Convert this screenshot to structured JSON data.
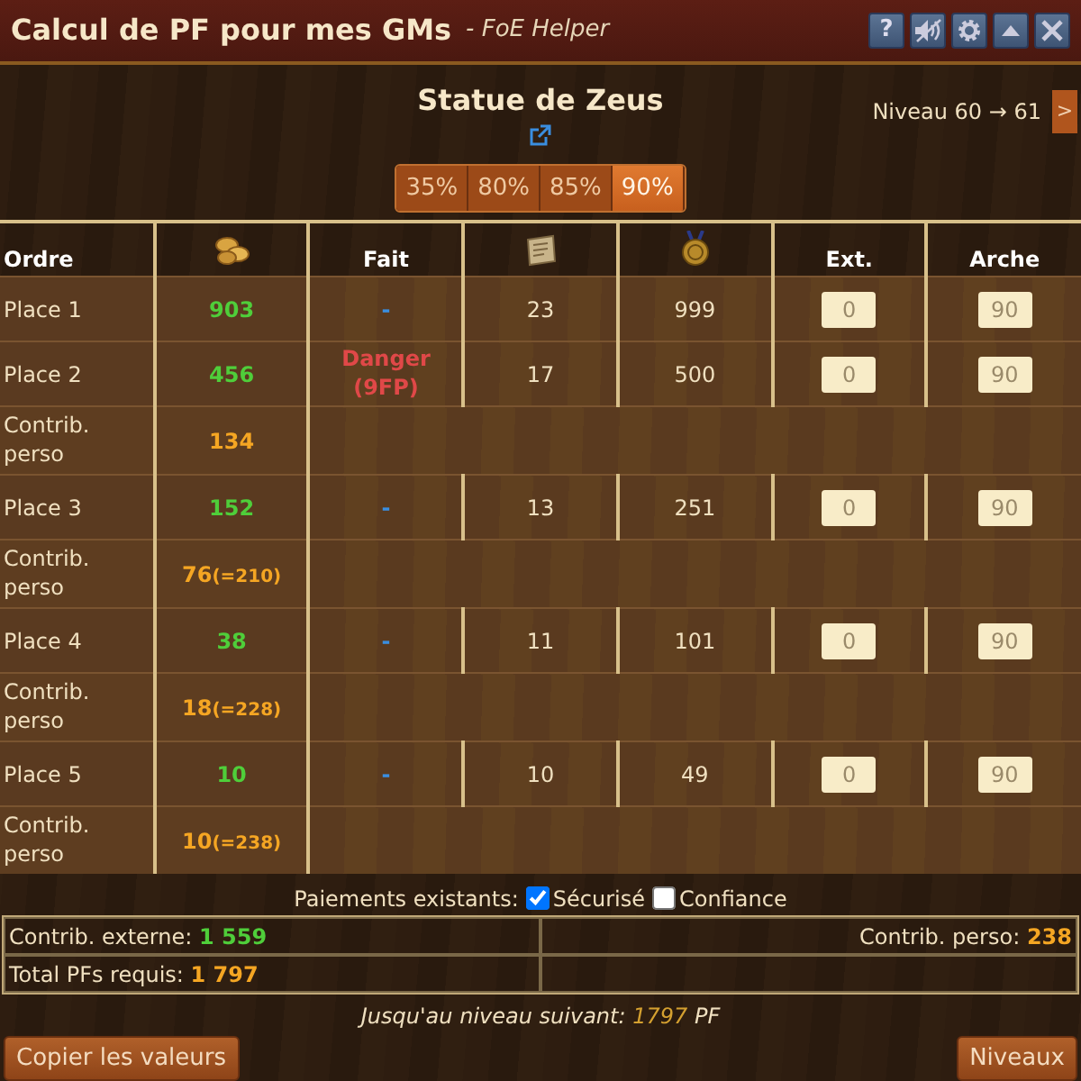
{
  "window": {
    "title": "Calcul de PF pour mes GMs",
    "subtitle": "- FoE Helper",
    "buttons": [
      {
        "kind": "help",
        "label": "?"
      },
      {
        "kind": "mute"
      },
      {
        "kind": "settings"
      },
      {
        "kind": "collapse"
      },
      {
        "kind": "close"
      }
    ]
  },
  "building": {
    "name": "Statue de Zeus",
    "level": "Niveau 60 → 61",
    "next": ">"
  },
  "percentages": [
    {
      "label": "35%",
      "selected": false
    },
    {
      "label": "80%",
      "selected": false
    },
    {
      "label": "85%",
      "selected": false
    },
    {
      "label": "90%",
      "selected": true
    }
  ],
  "columns": [
    {
      "kind": "text",
      "label": "Ordre"
    },
    {
      "kind": "fp-icon"
    },
    {
      "kind": "text",
      "label": "Fait"
    },
    {
      "kind": "blueprint-icon"
    },
    {
      "kind": "medal-icon"
    },
    {
      "kind": "text",
      "label": "Ext."
    },
    {
      "kind": "text",
      "label": "Arche"
    }
  ],
  "rows": [
    {
      "kind": "place",
      "label": "Place 1",
      "fp": "903",
      "fait": "-",
      "danger": false,
      "blueprints": "23",
      "medals": "999",
      "ext": "0",
      "arche": "90"
    },
    {
      "kind": "place",
      "label": "Place 2",
      "fp": "456",
      "fait": "Danger (9FP)",
      "danger": true,
      "blueprints": "17",
      "medals": "500",
      "ext": "0",
      "arche": "90"
    },
    {
      "kind": "contrib",
      "label": "Contrib. perso",
      "value": "134"
    },
    {
      "kind": "place",
      "label": "Place 3",
      "fp": "152",
      "fait": "-",
      "danger": false,
      "blueprints": "13",
      "medals": "251",
      "ext": "0",
      "arche": "90"
    },
    {
      "kind": "contrib",
      "label": "Contrib. perso",
      "value": "76",
      "total": "(=210)"
    },
    {
      "kind": "place",
      "label": "Place 4",
      "fp": "38",
      "fait": "-",
      "danger": false,
      "blueprints": "11",
      "medals": "101",
      "ext": "0",
      "arche": "90"
    },
    {
      "kind": "contrib",
      "label": "Contrib. perso",
      "value": "18",
      "total": "(=228)"
    },
    {
      "kind": "place",
      "label": "Place 5",
      "fp": "10",
      "fait": "-",
      "danger": false,
      "blueprints": "10",
      "medals": "49",
      "ext": "0",
      "arche": "90"
    },
    {
      "kind": "contrib",
      "label": "Contrib. perso",
      "value": "10",
      "total": "(=238)"
    }
  ],
  "payments": {
    "label": "Paiements existants:",
    "options": [
      {
        "label": "Sécurisé",
        "checked": true
      },
      {
        "label": "Confiance",
        "checked": false
      }
    ]
  },
  "summary": {
    "external_label": "Contrib. externe:",
    "external": "1 559",
    "own_label": "Contrib. perso:",
    "own": "238",
    "total_label": "Total PFs requis:",
    "total": "1 797"
  },
  "next_level": {
    "label": "Jusqu'au niveau suivant:",
    "value": "1797",
    "unit": "PF"
  },
  "buttons": [
    {
      "label": "Copier les valeurs"
    },
    {
      "label": "Niveaux"
    }
  ]
}
